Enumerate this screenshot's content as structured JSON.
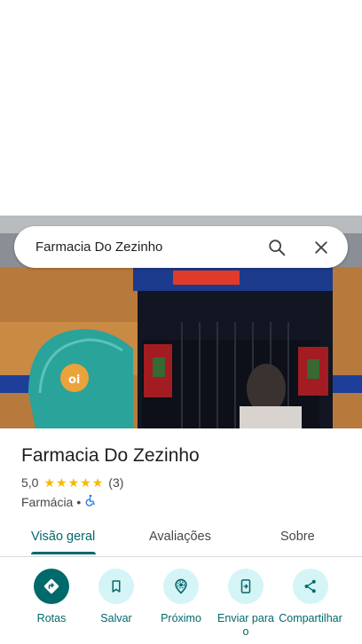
{
  "search": {
    "query": "Farmacia Do Zezinho"
  },
  "place": {
    "name": "Farmacia Do Zezinho",
    "rating": "5,0",
    "review_count": "(3)",
    "category": "Farmácia",
    "separator": "•"
  },
  "tabs": [
    {
      "label": "Visão geral",
      "active": true
    },
    {
      "label": "Avaliações",
      "active": false
    },
    {
      "label": "Sobre",
      "active": false
    }
  ],
  "actions": [
    {
      "label": "Rotas",
      "icon": "directions-icon"
    },
    {
      "label": "Salvar",
      "icon": "bookmark-icon"
    },
    {
      "label": "Próximo",
      "icon": "nearby-icon"
    },
    {
      "label": "Enviar para o",
      "icon": "send-to-phone-icon"
    },
    {
      "label": "Compartilhar",
      "icon": "share-icon"
    }
  ],
  "photo_sign_text": "oi",
  "colors": {
    "accent": "#00696b",
    "tonal_button": "#d5f4f6",
    "star": "#f6b800"
  }
}
